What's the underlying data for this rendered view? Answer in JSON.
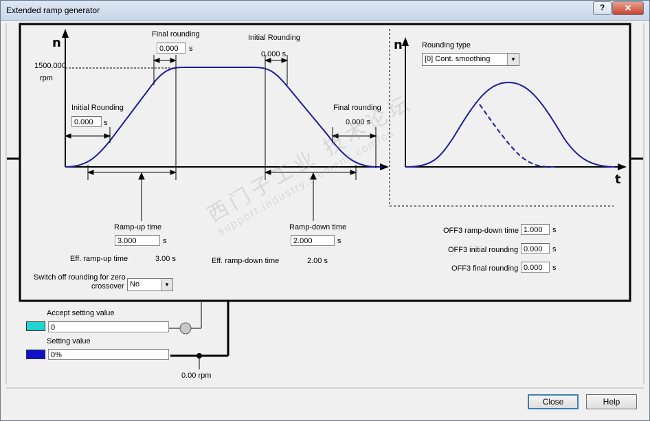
{
  "window": {
    "title": "Extended ramp generator",
    "help_glyph": "?",
    "close_glyph": "✕"
  },
  "diagram": {
    "n_label": "n",
    "t_label": "t",
    "max_speed": "1500.000",
    "max_speed_unit": "rpm",
    "final_rounding_label": "Final rounding",
    "final_rounding_value": "0.000",
    "initial_rounding_top_label": "Initial Rounding",
    "initial_rounding_top_value": "0.000 s",
    "initial_rounding_left_label": "Initial Rounding",
    "initial_rounding_left_value": "0.000",
    "final_rounding_right_label": "Final rounding",
    "final_rounding_right_value": "0.000 s",
    "ramp_up_label": "Ramp-up time",
    "ramp_up_value": "3.000",
    "ramp_down_label": "Ramp-down time",
    "ramp_down_value": "2.000",
    "eff_ramp_up_label": "Eff. ramp-up time",
    "eff_ramp_up_value": "3.00 s",
    "eff_ramp_down_label": "Eff. ramp-down time",
    "eff_ramp_down_value": "2.00 s",
    "switch_off_label_1": "Switch off rounding for zero",
    "switch_off_label_2": "crossover",
    "switch_off_value": "No",
    "unit_s": "s"
  },
  "rounding": {
    "label": "Rounding type",
    "value": "[0] Cont. smoothing"
  },
  "off3": {
    "ramp_down_label": "OFF3 ramp-down time",
    "ramp_down_value": "1.000",
    "initial_label": "OFF3 initial rounding",
    "initial_value": "0.000",
    "final_label": "OFF3 final rounding",
    "final_value": "0.000"
  },
  "inputs": {
    "accept_label": "Accept setting value",
    "accept_value": "0",
    "setting_label": "Setting value",
    "setting_value": "0%",
    "output_value": "0.00 rpm"
  },
  "colors": {
    "curve": "#1a1a9e",
    "accept_swatch": "#22d3d3",
    "setting_swatch": "#1010c8"
  },
  "buttons": {
    "close": "Close",
    "help": "Help"
  },
  "watermark": {
    "cn": "西门子工业  技术论坛",
    "url": "support.industry.siemens.com/cs"
  }
}
